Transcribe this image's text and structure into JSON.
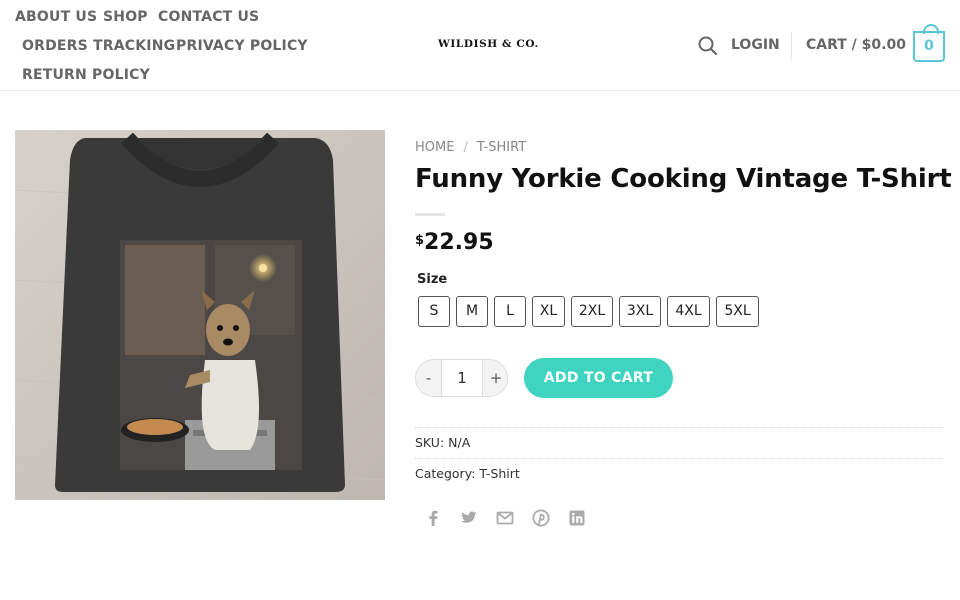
{
  "header": {
    "nav_row1": [
      "ABOUT US",
      "SHOP",
      "CONTACT US"
    ],
    "nav_row2": [
      "ORDERS TRACKING",
      "PRIVACY POLICY"
    ],
    "nav_row3": [
      "RETURN POLICY"
    ],
    "logo": "WILDISH & CO.",
    "login": "LOGIN",
    "cart_label": "CART / $0.00",
    "cart_count": "0"
  },
  "breadcrumb": {
    "home": "HOME",
    "separator": "/",
    "category": "T-SHIRT"
  },
  "product": {
    "title": "Funny Yorkie Cooking Vintage T-Shirt",
    "currency": "$",
    "price": "22.95",
    "size_label": "Size",
    "sizes": [
      "S",
      "M",
      "L",
      "XL",
      "2XL",
      "3XL",
      "4XL",
      "5XL"
    ],
    "qty_minus": "-",
    "qty_value": "1",
    "qty_plus": "+",
    "add_to_cart": "ADD TO CART",
    "sku_label": "SKU:",
    "sku_value": "N/A",
    "category_label": "Category:",
    "category_value": "T-Shirt"
  },
  "share_icons": [
    "facebook-icon",
    "twitter-icon",
    "email-icon",
    "pinterest-icon",
    "linkedin-icon"
  ],
  "colors": {
    "accent": "#5bc6d8",
    "button": "#3fd4c0",
    "shirt": "#3a3a3a"
  }
}
